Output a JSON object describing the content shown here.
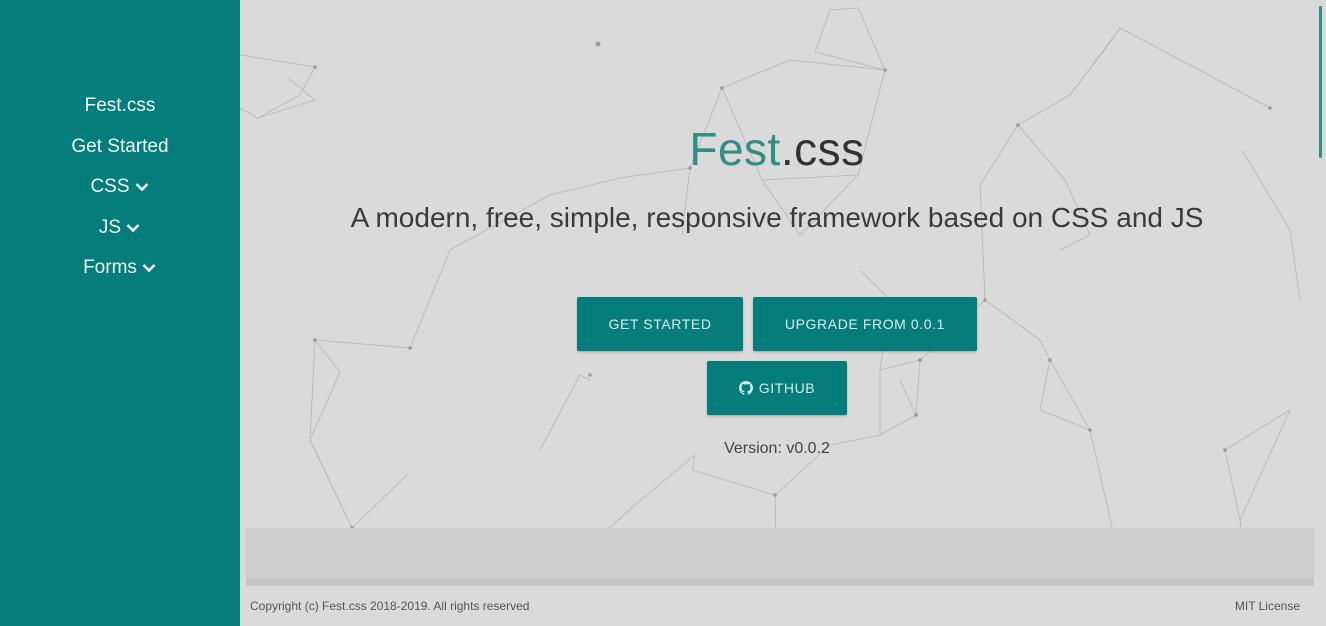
{
  "sidebar": {
    "items": [
      {
        "label": "Fest.css",
        "has_dropdown": false
      },
      {
        "label": "Get Started",
        "has_dropdown": false
      },
      {
        "label": "CSS",
        "has_dropdown": true
      },
      {
        "label": "JS",
        "has_dropdown": true
      },
      {
        "label": "Forms",
        "has_dropdown": true
      }
    ],
    "dropdown_icon": "chevron-down-icon"
  },
  "hero": {
    "title_accent": "Fest",
    "title_rest": ".css",
    "subtitle": "A modern, free, simple, responsive framework based on CSS and JS",
    "buttons": {
      "get_started": "GET STARTED",
      "upgrade": "UPGRADE FROM 0.0.1",
      "github": "GITHUB"
    },
    "github_icon": "github-icon",
    "version": "Version: v0.0.2"
  },
  "footer": {
    "copyright": "Copyright (c) Fest.css 2018-2019. All rights reserved",
    "license": "MIT License"
  },
  "colors": {
    "sidebar_bg": "#047d7b",
    "accent": "#2e8f82",
    "button_bg": "#047d7b",
    "page_bg": "#dadada"
  }
}
